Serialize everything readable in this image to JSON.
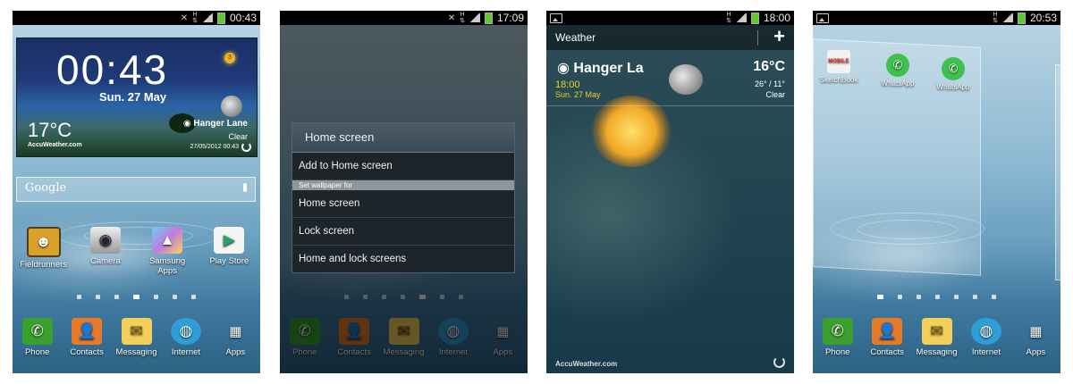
{
  "panel1": {
    "status_time": "00:43",
    "clock_time": "00:43",
    "clock_date": "Sun. 27 May",
    "temp": "17°C",
    "location": "Hanger Lane",
    "condition": "Clear",
    "updated": "27/05/2012 00:43",
    "accuweather": "AccuWeather.com",
    "sun_badge": "3",
    "search_label": "Google",
    "apps": [
      "Fieldrunners",
      "Camera",
      "Samsung Apps",
      "Play Store"
    ]
  },
  "panel2": {
    "status_time": "17:09",
    "dialog_title": "Home screen",
    "add_item": "Add to Home screen",
    "section": "Set wallpaper for",
    "options": [
      "Home screen",
      "Lock screen",
      "Home and lock screens"
    ]
  },
  "panel3": {
    "status_time": "18:00",
    "title": "Weather",
    "add": "+",
    "location": "Hanger La",
    "time": "18:00",
    "date": "Sun. 27 May",
    "temp": "16°C",
    "minmax": "26° / 11°",
    "condition": "Clear",
    "footer": "AccuWeather.com"
  },
  "panel4": {
    "status_time": "20:53",
    "apps": [
      "SketchBook",
      "WhatsApp",
      "WhatsApp"
    ],
    "sketch_badge": "MOBILE"
  },
  "dock": [
    "Phone",
    "Contacts",
    "Messaging",
    "Internet",
    "Apps"
  ],
  "colors": {
    "phone": "#3a9f2d",
    "contacts": "#e47a2a",
    "internet": "#2f9ed7",
    "battery": "#5ccb2b",
    "weather_accent": "#f0d31e"
  }
}
